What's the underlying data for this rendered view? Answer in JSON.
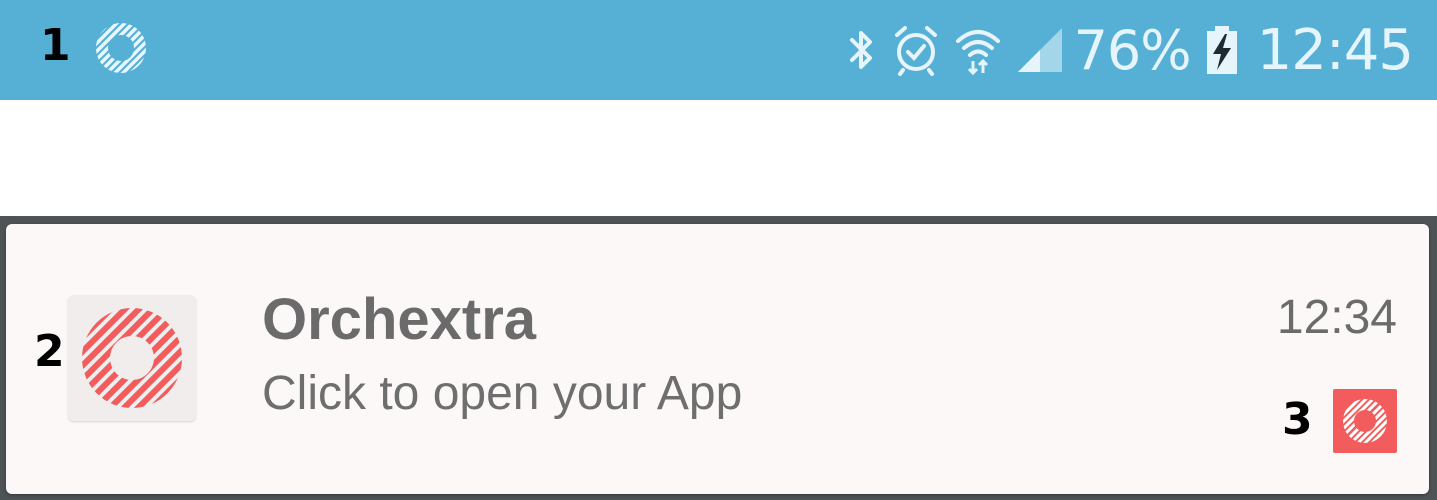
{
  "callouts": {
    "one": "1",
    "two": "2",
    "three": "3"
  },
  "status_bar": {
    "app_icon": "orchextra-ring-icon",
    "icons": [
      "bluetooth-icon",
      "alarm-icon",
      "wifi-icon",
      "signal-icon",
      "battery-charging-icon"
    ],
    "battery_percent": "76%",
    "time": "12:45",
    "background_color": "#56b0d5"
  },
  "notification": {
    "app_name": "Orchextra",
    "message": "Click to open your App",
    "time": "12:34",
    "icon": "orchextra-ring-icon",
    "small_icon": "orchextra-ring-icon",
    "accent_color": "#f25c5c"
  }
}
